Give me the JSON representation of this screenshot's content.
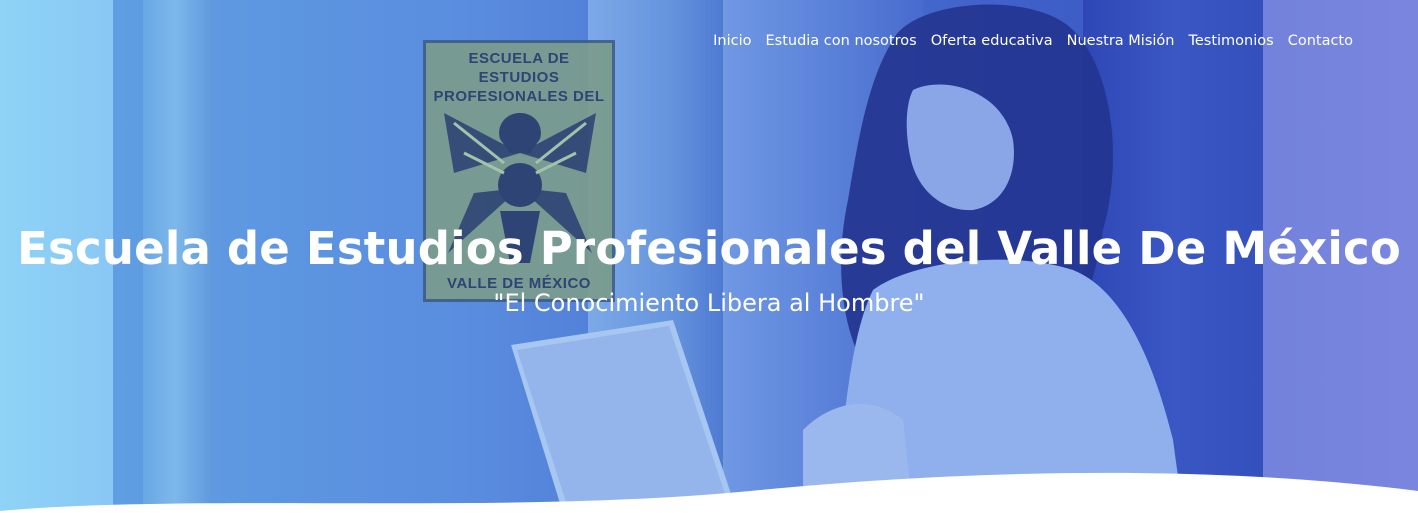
{
  "nav": {
    "items": [
      {
        "label": "Inicio"
      },
      {
        "label": "Estudia con nosotros"
      },
      {
        "label": "Oferta educativa"
      },
      {
        "label": "Nuestra Misión"
      },
      {
        "label": "Testimonios"
      },
      {
        "label": "Contacto"
      }
    ]
  },
  "hero": {
    "title": "Escuela de Estudios Profesionales del Valle De México",
    "subtitle": "\"El Conocimiento Libera al Hombre\""
  },
  "logo": {
    "line1": "ESCUELA DE ESTUDIOS",
    "line2": "PROFESIONALES DEL",
    "line3": "VALLE DE MÉXICO"
  },
  "colors": {
    "text": "#ffffff",
    "overlay_left": "#8fd3f7",
    "overlay_right": "#6e7fdb"
  }
}
